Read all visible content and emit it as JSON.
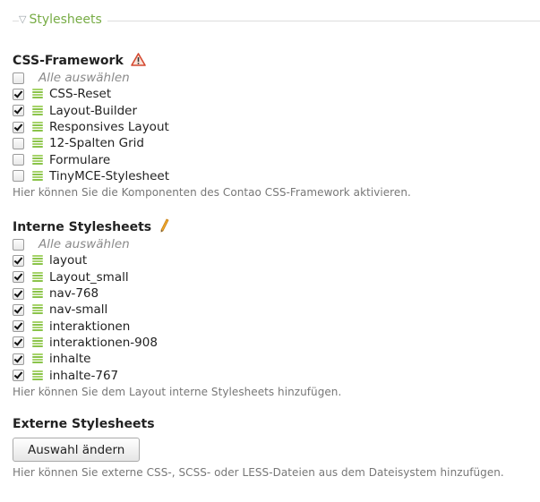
{
  "legend": {
    "label": "Stylesheets",
    "icon": "triangle-down-icon"
  },
  "framework": {
    "title": "CSS-Framework",
    "title_icon": "warning-icon",
    "select_all": "Alle auswählen",
    "items": [
      {
        "label": "CSS-Reset",
        "checked": true
      },
      {
        "label": "Layout-Builder",
        "checked": true
      },
      {
        "label": "Responsives Layout",
        "checked": true
      },
      {
        "label": "12-Spalten Grid",
        "checked": false
      },
      {
        "label": "Formulare",
        "checked": false
      },
      {
        "label": "TinyMCE-Stylesheet",
        "checked": false
      }
    ],
    "help": "Hier können Sie die Komponenten des Contao CSS-Framework aktivieren."
  },
  "internal": {
    "title": "Interne Stylesheets",
    "title_icon": "pencil-icon",
    "select_all": "Alle auswählen",
    "items": [
      {
        "label": "layout",
        "checked": true
      },
      {
        "label": "Layout_small",
        "checked": true
      },
      {
        "label": "nav-768",
        "checked": true
      },
      {
        "label": "nav-small",
        "checked": true
      },
      {
        "label": "interaktionen",
        "checked": true
      },
      {
        "label": "interaktionen-908",
        "checked": true
      },
      {
        "label": "inhalte",
        "checked": true
      },
      {
        "label": "inhalte-767",
        "checked": true
      }
    ],
    "help": "Hier können Sie dem Layout interne Stylesheets hinzufügen."
  },
  "external": {
    "title": "Externe Stylesheets",
    "button": "Auswahl ändern",
    "help": "Hier können Sie externe CSS-, SCSS- oder LESS-Dateien aus dem Dateisystem hinzufügen."
  },
  "colors": {
    "accent": "#77ac45",
    "sheet_icon": "#8ac34a",
    "help_text": "#777777"
  }
}
